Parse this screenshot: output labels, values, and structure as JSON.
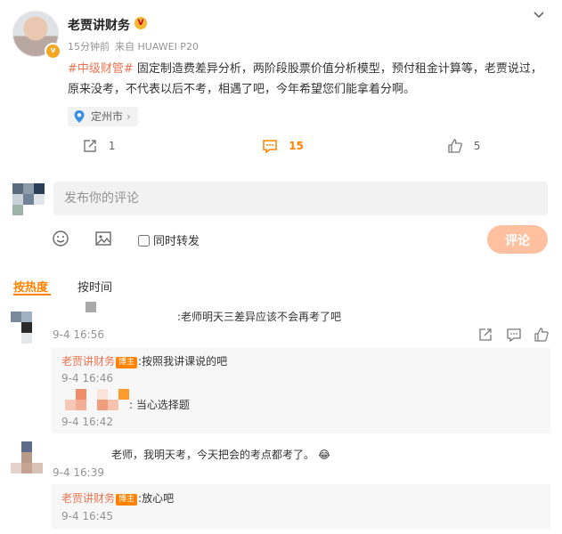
{
  "post": {
    "author": "老贾讲财务",
    "time": "15分钟前",
    "source": "来自 HUAWEI P20",
    "tag": "#中级财管#",
    "body": " 固定制造费差异分析，两阶段股票价值分析模型，预付租金计算等，老贾说过，原来没考，不代表以后不考，相遇了吧，今年希望您们能拿着分啊。",
    "location": "定州市",
    "repost_count": "1",
    "comment_count": "15",
    "like_count": "5"
  },
  "composer": {
    "placeholder": "发布你的评论",
    "forward_label": "同时转发",
    "submit_label": "评论"
  },
  "sort": {
    "hot": "按热度",
    "time": "按时间"
  },
  "comments": [
    {
      "text": ":老师明天三差异应该不会再考了吧",
      "time": "9-4 16:56",
      "replies": [
        {
          "author": "老贾讲财务",
          "badge": "博主",
          "text": ":按照我讲课说的吧",
          "time": "9-4 16:46"
        },
        {
          "author": "",
          "badge": "",
          "text": ": 当心选择题",
          "time": "9-4 16:42"
        }
      ]
    },
    {
      "text": "老师，我明天考，今天把会的考点都考了。",
      "emoji": "😂",
      "time": "9-4 16:39",
      "replies": [
        {
          "author": "老贾讲财务",
          "badge": "博主",
          "text": ":放心吧",
          "time": "9-4 16:45"
        }
      ]
    }
  ],
  "colors": {
    "accent": "#ff8200",
    "name": "#eb7350",
    "submit_disabled": "#ffc09f"
  }
}
